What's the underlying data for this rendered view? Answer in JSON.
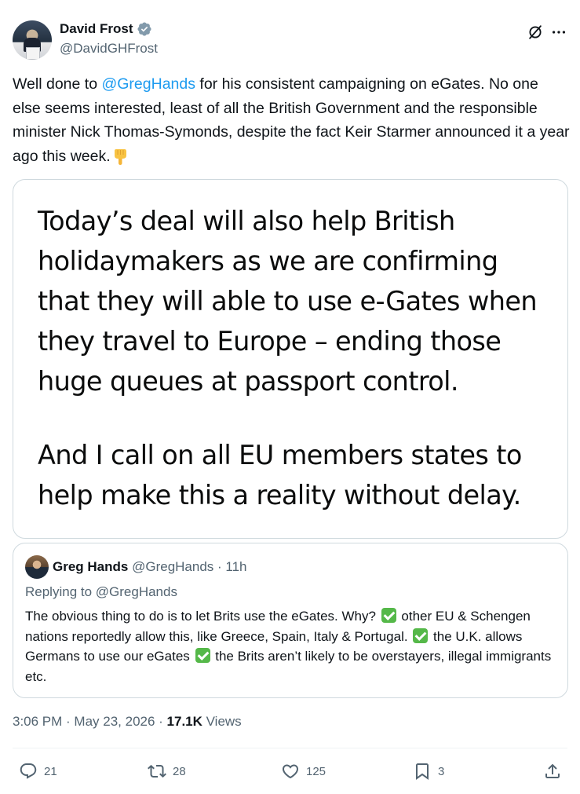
{
  "author": {
    "display_name": "David Frost",
    "handle": "@DavidGHFrost"
  },
  "tweet": {
    "text_before": "Well done to ",
    "mention": "@GregHands",
    "text_after": " for his consistent campaigning on eGates.  No one else seems interested, least of all the British Government and the responsible minister Nick Thomas-Symonds, despite the fact Keir Starmer announced it a year ago this week."
  },
  "image_card": {
    "paragraph_1": "Today’s deal will also help British holidaymakers as we are confirming that they will able to use e-Gates when they travel to Europe – ending those huge queues at passport control.",
    "paragraph_2": "And I call on all EU members states to help make this a reality without delay."
  },
  "quoted_tweet": {
    "display_name": "Greg Hands",
    "meta": "@GregHands · 11h",
    "replying_to": "Replying to @GregHands",
    "segment_1": "The obvious thing to do is to let Brits use the eGates. Why? ",
    "segment_2": " other EU & Schengen nations reportedly allow this, like Greece, Spain, Italy & Portugal. ",
    "segment_3": " the U.K. allows Germans to use our eGates  ",
    "segment_4": " the Brits aren’t likely to be overstayers, illegal immigrants etc."
  },
  "meta": {
    "time_date": "3:06 PM · May 23, 2026 · ",
    "views_count": "17.1K",
    "views_label": " Views"
  },
  "actions": {
    "replies": "21",
    "reposts": "28",
    "likes": "125",
    "bookmarks": "3"
  },
  "colors": {
    "link": "#1d9bf0",
    "verified": "#829aab",
    "secondary_text": "#536471",
    "check_emoji": "#55b849"
  },
  "icons": [
    "verified-badge-icon",
    "grok-icon",
    "more-icon",
    "pointing-down-emoji-icon",
    "check-mark-emoji-icon",
    "reply-icon",
    "repost-icon",
    "like-icon",
    "bookmark-icon",
    "share-icon"
  ]
}
